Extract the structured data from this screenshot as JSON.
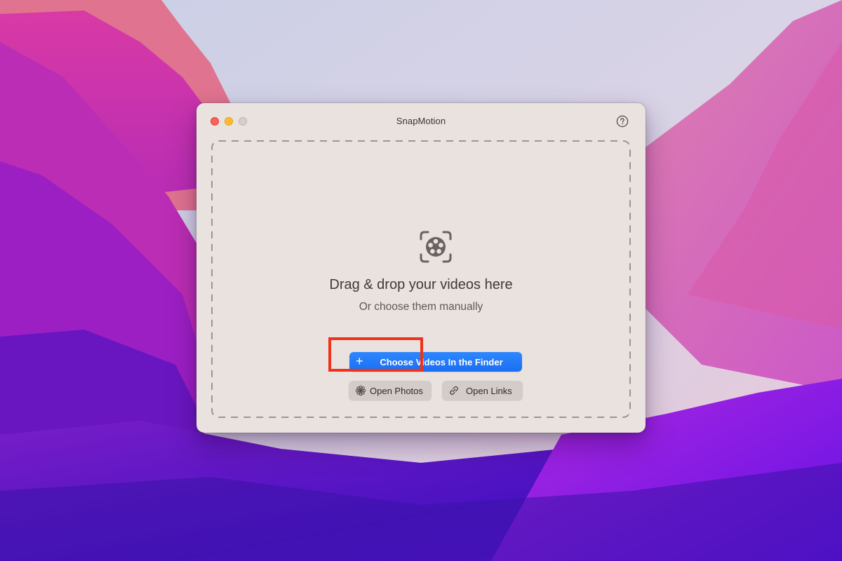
{
  "window": {
    "title": "SnapMotion",
    "controls": {
      "close": "close-window",
      "minimize": "minimize-window",
      "zoom": "zoom-window-disabled"
    },
    "help_icon": "question-circle-icon"
  },
  "dropzone": {
    "icon": "film-reel-viewfinder-icon",
    "title": "Drag & drop your videos here",
    "subtitle": "Or choose them manually"
  },
  "buttons": {
    "choose_finder": {
      "icon": "plus-icon",
      "label": "Choose Videos In the Finder"
    },
    "open_photos": {
      "icon": "photos-flower-icon",
      "label": "Open Photos"
    },
    "open_links": {
      "icon": "link-icon",
      "label": "Open Links"
    }
  },
  "annotation": {
    "highlighted_element": "open_photos",
    "color": "#f0321a"
  },
  "colors": {
    "window_bg": "#e9e2df",
    "accent": "#1f77f7",
    "secondary_button": "#d3ccc9",
    "traffic_close": "#fe5f57",
    "traffic_minimize": "#febc2e",
    "traffic_disabled": "#d3cfcd"
  }
}
